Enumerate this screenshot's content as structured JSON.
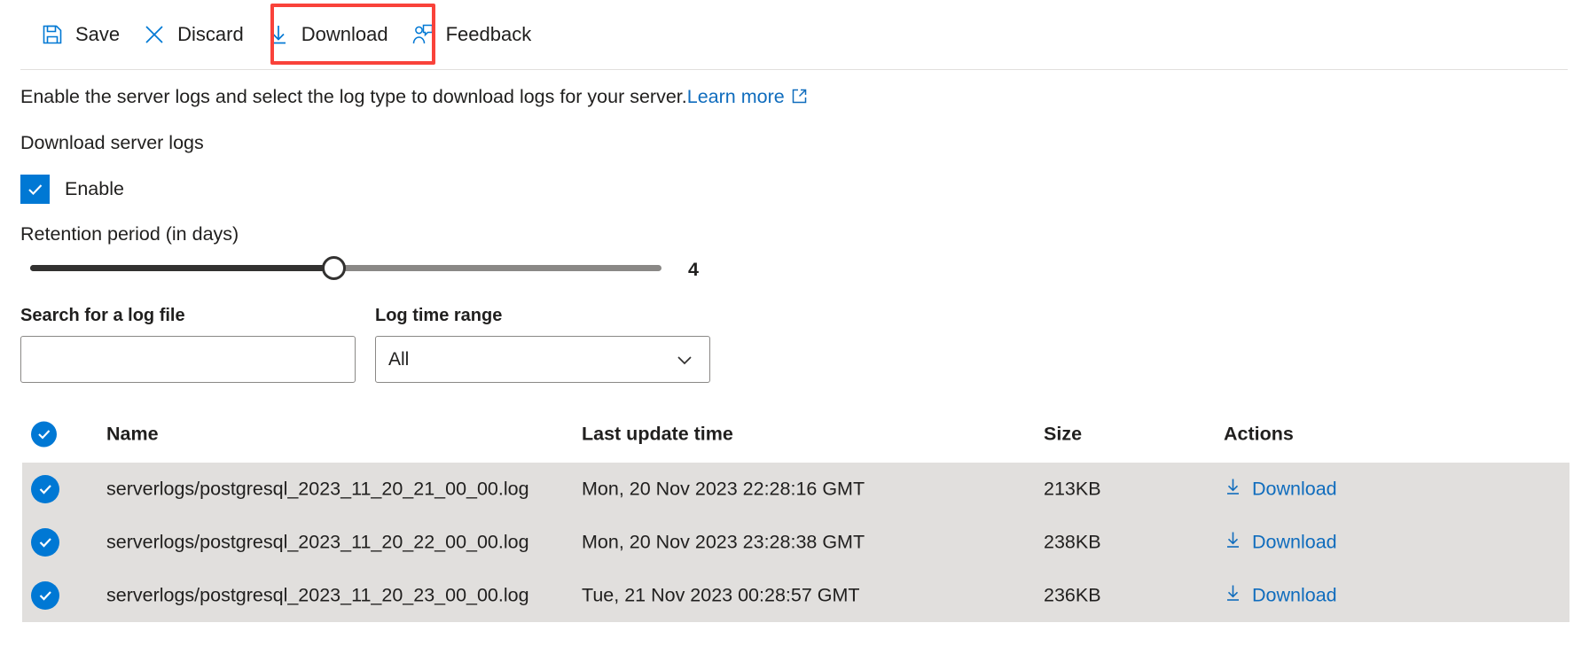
{
  "toolbar": {
    "items": [
      {
        "label": "Save",
        "icon": "save-icon"
      },
      {
        "label": "Discard",
        "icon": "discard-icon"
      },
      {
        "label": "Download",
        "icon": "download-icon"
      },
      {
        "label": "Feedback",
        "icon": "feedback-icon"
      }
    ],
    "highlight_label": "Download",
    "highlight_color": "#f9423a"
  },
  "description": {
    "text": "Enable the server logs and select the log type to download logs for your server.",
    "link_label": "Learn more",
    "link_icon": "external-link-icon"
  },
  "section": {
    "title": "Download server logs"
  },
  "enable": {
    "label": "Enable",
    "checked": true,
    "checkbox_color": "#0078d4"
  },
  "retention": {
    "label": "Retention period (in days)",
    "value": "4",
    "min": 1,
    "max": 7
  },
  "filters": {
    "search": {
      "label": "Search for a log file",
      "value": "",
      "placeholder": ""
    },
    "time_range": {
      "label": "Log time range",
      "selected": "All",
      "options": [
        "All"
      ],
      "chevron_icon": "chevron-down-icon"
    }
  },
  "table": {
    "select_all_checked": true,
    "columns": [
      "Name",
      "Last update time",
      "Size",
      "Actions"
    ],
    "action_label": "Download",
    "rows": [
      {
        "checked": true,
        "name": "serverlogs/postgresql_2023_11_20_21_00_00.log",
        "last_update_time": "Mon, 20 Nov 2023 22:28:16 GMT",
        "size": "213KB",
        "action": "Download"
      },
      {
        "checked": true,
        "name": "serverlogs/postgresql_2023_11_20_22_00_00.log",
        "last_update_time": "Mon, 20 Nov 2023 23:28:38 GMT",
        "size": "238KB",
        "action": "Download"
      },
      {
        "checked": true,
        "name": "serverlogs/postgresql_2023_11_20_23_00_00.log",
        "last_update_time": "Tue, 21 Nov 2023 00:28:57 GMT",
        "size": "236KB",
        "action": "Download"
      }
    ]
  },
  "colors": {
    "accent": "#0078d4",
    "link": "#0f6cbd",
    "row_bg": "#e1dfdd",
    "highlight": "#f9423a"
  }
}
